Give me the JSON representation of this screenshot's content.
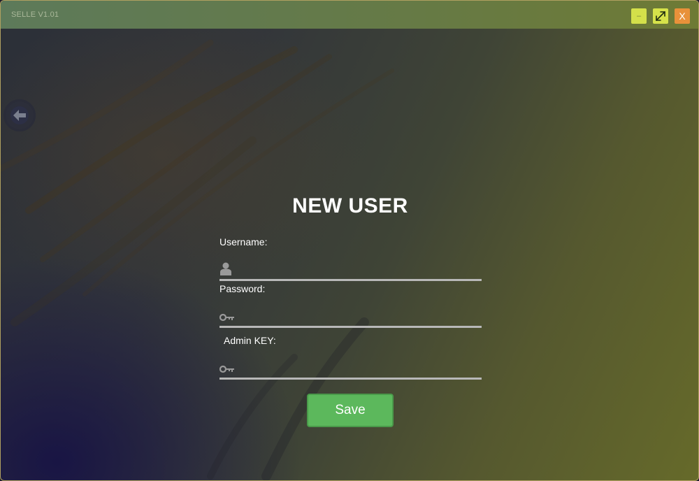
{
  "window": {
    "title": "SELLE V1.01",
    "minimize_label": "–",
    "close_label": "X"
  },
  "form": {
    "heading": "NEW USER",
    "username": {
      "label": "Username:",
      "value": "",
      "placeholder": ""
    },
    "password": {
      "label": "Password:",
      "value": "",
      "placeholder": ""
    },
    "admin_key": {
      "label": "Admin KEY:",
      "value": "",
      "placeholder": ""
    },
    "save_label": "Save"
  },
  "icons": {
    "back": "arrow-left-icon",
    "username": "user-icon",
    "password": "key-icon",
    "admin_key": "key-icon",
    "maximize": "expand-icon"
  },
  "colors": {
    "save_button": "#5cb85c",
    "minimize_button": "#d4e04a",
    "maximize_button": "#d6e24a",
    "close_button": "#e8913a",
    "field_underline": "#b8b8b8"
  }
}
